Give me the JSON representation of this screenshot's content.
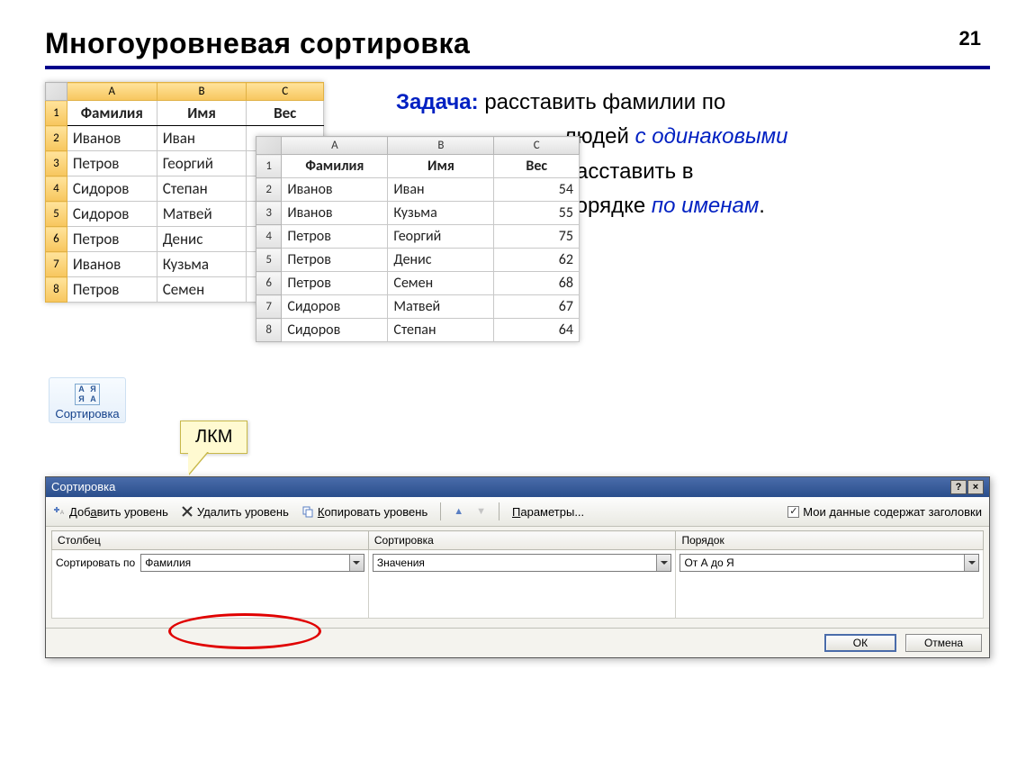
{
  "page_number": "21",
  "title": "Многоуровневая сортировка",
  "task": {
    "label": "Задача:",
    "line1": "расставить фамилии по",
    "line2_a": "людей ",
    "line2_b": "с одинаковыми",
    "line3_a": "расставить в",
    "line4_a": "порядке ",
    "line4_b": "по именам",
    "line4_c": "."
  },
  "table1": {
    "cols": [
      "A",
      "B",
      "C"
    ],
    "header": [
      "Фамилия",
      "Имя",
      "Вес"
    ],
    "rows": [
      [
        "Иванов",
        "Иван",
        ""
      ],
      [
        "Петров",
        "Георгий",
        ""
      ],
      [
        "Сидоров",
        "Степан",
        ""
      ],
      [
        "Сидоров",
        "Матвей",
        ""
      ],
      [
        "Петров",
        "Денис",
        ""
      ],
      [
        "Иванов",
        "Кузьма",
        ""
      ],
      [
        "Петров",
        "Семен",
        ""
      ]
    ]
  },
  "table2": {
    "cols": [
      "A",
      "B",
      "C"
    ],
    "header": [
      "Фамилия",
      "Имя",
      "Вес"
    ],
    "rows": [
      [
        "Иванов",
        "Иван",
        "54"
      ],
      [
        "Иванов",
        "Кузьма",
        "55"
      ],
      [
        "Петров",
        "Георгий",
        "75"
      ],
      [
        "Петров",
        "Денис",
        "62"
      ],
      [
        "Петров",
        "Семен",
        "68"
      ],
      [
        "Сидоров",
        "Матвей",
        "67"
      ],
      [
        "Сидоров",
        "Степан",
        "64"
      ]
    ]
  },
  "sort_button_label": "Сортировка",
  "callout": "ЛКМ",
  "dialog": {
    "title": "Сортировка",
    "toolbar": {
      "add": "Добавить уровень",
      "del": "Удалить уровень",
      "copy": "Копировать уровень",
      "params": "Параметры...",
      "headers": "Мои данные содержат заголовки"
    },
    "grid_headers": [
      "Столбец",
      "Сортировка",
      "Порядок"
    ],
    "row": {
      "label": "Сортировать по",
      "col_value": "Фамилия",
      "sort_value": "Значения",
      "order_value": "От А до Я"
    },
    "buttons": {
      "ok": "ОК",
      "cancel": "Отмена"
    }
  }
}
